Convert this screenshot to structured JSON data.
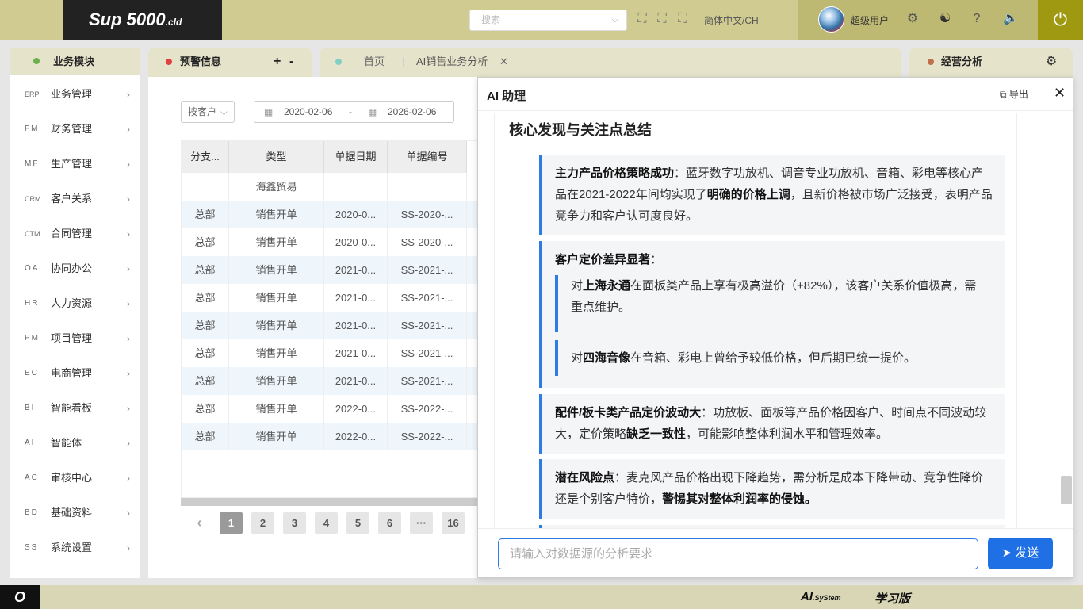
{
  "header": {
    "logo_main": "Sup  5000",
    "logo_sub": ".cld",
    "search_placeholder": "搜索",
    "language": "简体中文/CH",
    "username": "超级用户"
  },
  "sidebar": {
    "title": "业务模块",
    "items": [
      {
        "code": "ERP",
        "label": "业务管理"
      },
      {
        "code": "FM",
        "label": "财务管理"
      },
      {
        "code": "MF",
        "label": "生产管理"
      },
      {
        "code": "CRM",
        "label": "客户关系"
      },
      {
        "code": "CTM",
        "label": "合同管理"
      },
      {
        "code": "OA",
        "label": "协同办公"
      },
      {
        "code": "HR",
        "label": "人力资源"
      },
      {
        "code": "PM",
        "label": "项目管理"
      },
      {
        "code": "EC",
        "label": "电商管理"
      },
      {
        "code": "BI",
        "label": "智能看板"
      },
      {
        "code": "AI",
        "label": "智能体"
      },
      {
        "code": "AC",
        "label": "审核中心"
      },
      {
        "code": "BD",
        "label": "基础资料"
      },
      {
        "code": "SS",
        "label": "系统设置"
      }
    ]
  },
  "tabs": {
    "alerts": "预警信息",
    "plus": "+",
    "minus": "-",
    "home": "首页",
    "active": "AI销售业务分析",
    "close_x": "✕",
    "analysis": "经营分析"
  },
  "filters": {
    "select": "按客户",
    "date_from": "2020-02-06",
    "date_sep": "-",
    "date_to": "2026-02-06"
  },
  "table": {
    "headers": [
      "分支...",
      "类型",
      "单据日期",
      "单据编号"
    ],
    "group_row": "海鑫贸易",
    "rows": [
      [
        "总部",
        "销售开单",
        "2020-0...",
        "SS-2020-..."
      ],
      [
        "总部",
        "销售开单",
        "2020-0...",
        "SS-2020-..."
      ],
      [
        "总部",
        "销售开单",
        "2021-0...",
        "SS-2021-..."
      ],
      [
        "总部",
        "销售开单",
        "2021-0...",
        "SS-2021-..."
      ],
      [
        "总部",
        "销售开单",
        "2021-0...",
        "SS-2021-..."
      ],
      [
        "总部",
        "销售开单",
        "2021-0...",
        "SS-2021-..."
      ],
      [
        "总部",
        "销售开单",
        "2021-0...",
        "SS-2021-..."
      ],
      [
        "总部",
        "销售开单",
        "2022-0...",
        "SS-2022-..."
      ],
      [
        "总部",
        "销售开单",
        "2022-0...",
        "SS-2022-..."
      ]
    ]
  },
  "pagination": {
    "prev": "‹",
    "pages": [
      "1",
      "2",
      "3",
      "4",
      "5",
      "6",
      "···",
      "16"
    ],
    "current": "1"
  },
  "ai": {
    "title": "AI 助理",
    "export": "导出",
    "close": "✕",
    "section_title": "核心发现与关注点总结",
    "card1": {
      "bold": "主力产品价格策略成功",
      "t1": "：蓝牙数字功放机、调音专业功放机、音箱、彩电等核心产品在2021-2022年间均实现了",
      "b2": "明确的价格上调",
      "t2": "，且新价格被市场广泛接受，表明产品竞争力和客户认可度良好。"
    },
    "card2": {
      "bold": "客户定价差异显著",
      "t1": "：",
      "sub1_pre": "对",
      "sub1_bold": "上海永通",
      "sub1_text": "在面板类产品上享有极高溢价（+82%），该客户关系价值极高，需重点维护。",
      "sub2_pre": "对",
      "sub2_bold": "四海音像",
      "sub2_text": "在音箱、彩电上曾给予较低价格，但后期已统一提价。"
    },
    "card3": {
      "bold": "配件/板卡类产品定价波动大",
      "t1": "：功放板、面板等产品价格因客户、时间点不同波动较大，定价策略",
      "b2": "缺乏一致性",
      "t2": "，可能影响整体利润水平和管理效率。"
    },
    "card4": {
      "bold": "潜在风险点",
      "t1": "：麦克风产品价格出现下降趋势，需分析是成本下降带动、竞争性降价还是个别客户特价，",
      "b2": "警惕其对整体利润率的侵蚀。"
    },
    "input_placeholder": "请输入对数据源的分析要求",
    "send": "发送"
  },
  "footer": {
    "left": "O",
    "ai_main": "AI",
    "ai_sub": ".SyStem",
    "learn": "学习版"
  },
  "colors": {
    "topbar": "#cfcb91",
    "accent_blue": "#1f6fe5",
    "power": "#9e9910"
  }
}
